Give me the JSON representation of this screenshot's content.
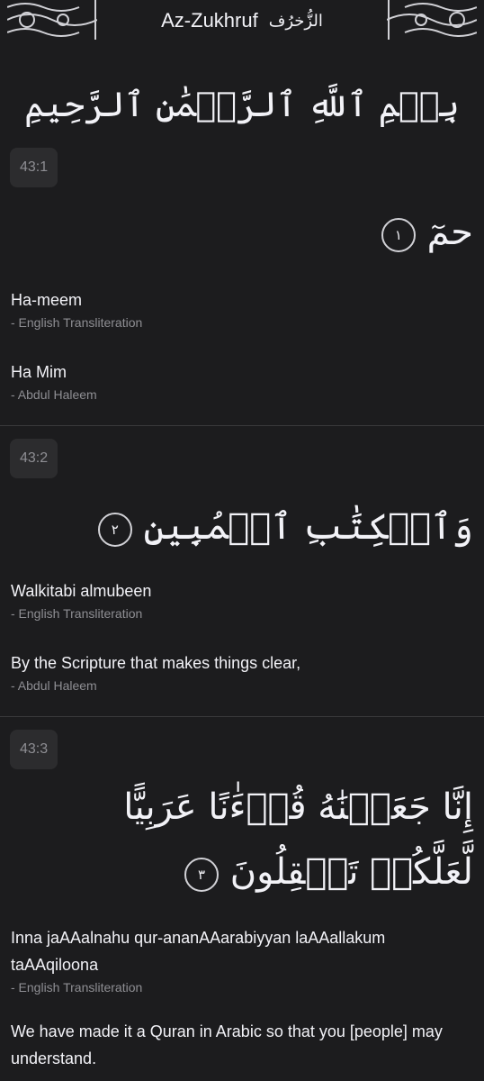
{
  "header": {
    "title": "Az-Zukhruf",
    "title_arabic": "الزُّخرُف"
  },
  "bismillah": "بِسۡمِ ٱللَّهِ ٱلرَّحۡمَٰنِ ٱلرَّحِيمِ",
  "verses": [
    {
      "ref": "43:1",
      "arabic": "حمٓ",
      "marker": "١",
      "translations": [
        {
          "text": "Ha-meem",
          "source": "- English Transliteration"
        },
        {
          "text": "Ha Mim",
          "source": "- Abdul Haleem"
        }
      ]
    },
    {
      "ref": "43:2",
      "arabic": "وَٱلۡكِتَٰبِ ٱلۡمُبِينِ",
      "marker": "٢",
      "translations": [
        {
          "text": "Walkitabi almubeen",
          "source": "- English Transliteration"
        },
        {
          "text": "By the Scripture that makes things clear,",
          "source": "- Abdul Haleem"
        }
      ]
    },
    {
      "ref": "43:3",
      "arabic": "إِنَّا جَعَلۡنَٰهُ قُرۡءَٰنًا عَرَبِيًّا لَّعَلَّكُمۡ تَعۡقِلُونَ",
      "marker": "٣",
      "translations": [
        {
          "text": "Inna jaAAalnahu qur-ananAAarabiyyan laAAallakum taAAqiloona",
          "source": "- English Transliteration"
        },
        {
          "text": "We have made it a Quran in Arabic so that you [people] may understand.",
          "source": ""
        }
      ]
    }
  ]
}
